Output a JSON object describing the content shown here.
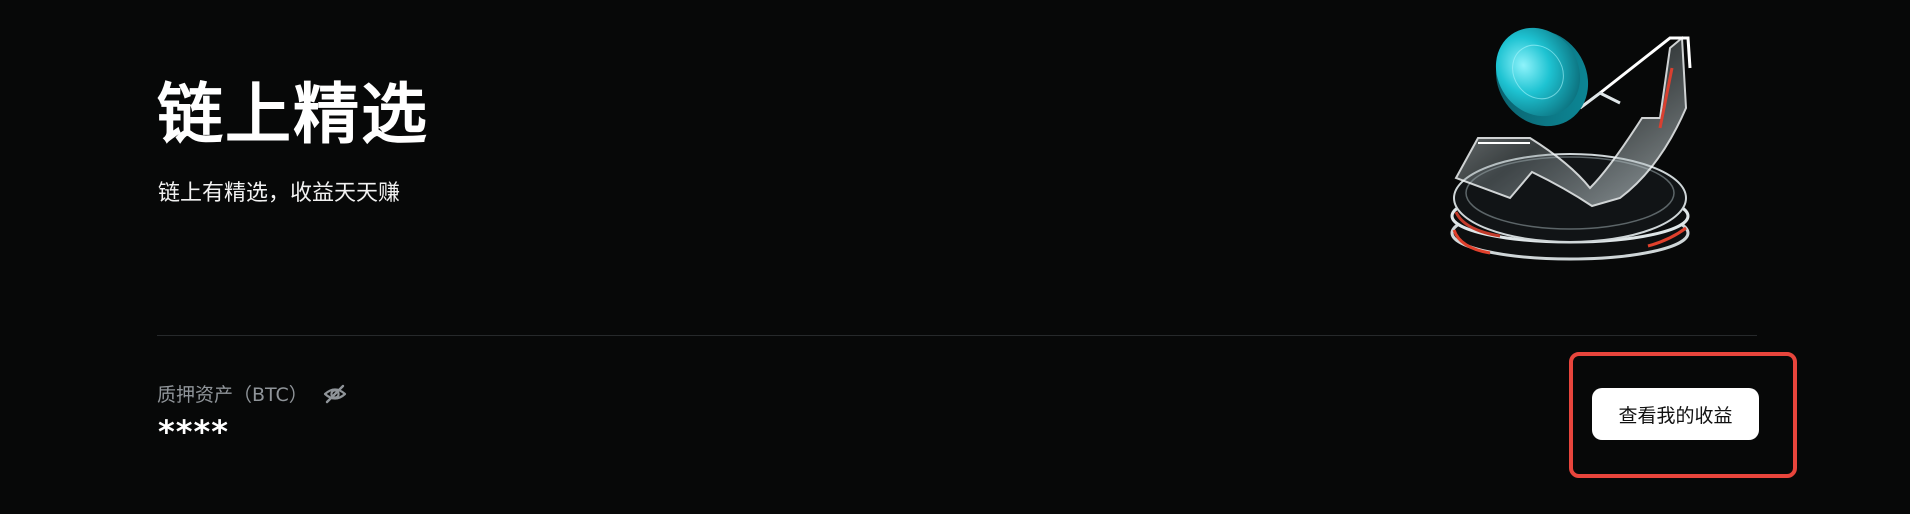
{
  "hero": {
    "title": "链上精选",
    "subtitle": "链上有精选，收益天天赚"
  },
  "asset": {
    "label": "质押资产（BTC）",
    "value": "****",
    "visibility_icon": "eye-off-icon"
  },
  "actions": {
    "view_earnings_label": "查看我的收益"
  },
  "colors": {
    "background": "#070808",
    "highlight": "#e8453c",
    "accent_coin": "#1ec3d2"
  },
  "illustration": {
    "icon": "coin-arrow-growth-illustration"
  }
}
